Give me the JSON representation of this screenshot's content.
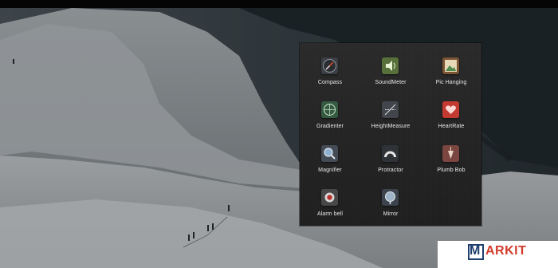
{
  "folder": {
    "apps": [
      {
        "label": "Compass",
        "icon": "compass-icon"
      },
      {
        "label": "SoundMeter",
        "icon": "sound-meter-icon"
      },
      {
        "label": "Pic Hanging",
        "icon": "picture-frame-icon"
      },
      {
        "label": "Gradienter",
        "icon": "level-icon"
      },
      {
        "label": "HeightMeasure",
        "icon": "height-measure-icon"
      },
      {
        "label": "HeartRate",
        "icon": "heart-icon"
      },
      {
        "label": "Magnifier",
        "icon": "magnifier-icon"
      },
      {
        "label": "Protractor",
        "icon": "protractor-icon"
      },
      {
        "label": "Plumb Bob",
        "icon": "plumb-bob-icon"
      },
      {
        "label": "Alarm bell",
        "icon": "alarm-bell-icon"
      },
      {
        "label": "Mirror",
        "icon": "mirror-icon"
      }
    ]
  },
  "watermark": {
    "first": "M",
    "rest": "ARKIT"
  },
  "colors": {
    "folder_bg": "#262626",
    "label": "#e8e8e8",
    "brand_blue": "#1f3f6e",
    "brand_red": "#d23b2a"
  }
}
